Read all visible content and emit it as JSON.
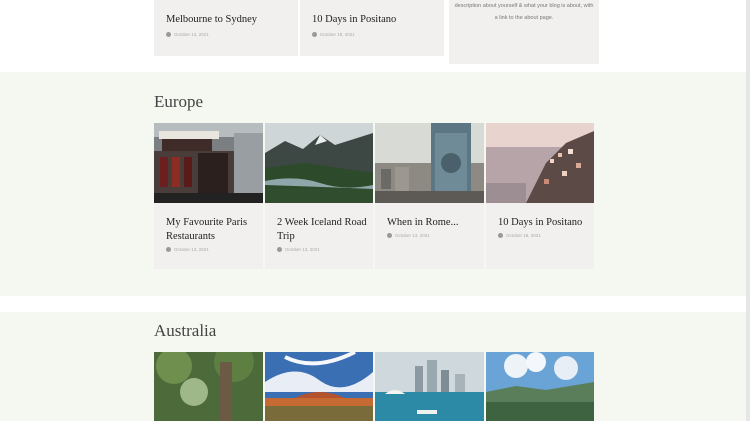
{
  "top_posts": [
    {
      "title": "Melbourne to Sydney",
      "date": "October 13, 2021"
    },
    {
      "title": "10 Days in Positano",
      "date": "October 18, 2021"
    }
  ],
  "about": {
    "text": "description about yourself & what your blog is about, with a link to the about page."
  },
  "sections": {
    "europe": {
      "title": "Europe",
      "posts": [
        {
          "title": "My Favourite Paris Restaurants",
          "date": "October 13, 2021",
          "image_icon": "paris-cafe-image"
        },
        {
          "title": "2 Week Iceland Road Trip",
          "date": "October 13, 2021",
          "image_icon": "iceland-fjord-image"
        },
        {
          "title": "When in Rome...",
          "date": "October 13, 2021",
          "image_icon": "rome-monument-image"
        },
        {
          "title": "10 Days in Positano",
          "date": "October 18, 2021",
          "image_icon": "positano-coast-image"
        }
      ]
    },
    "australia": {
      "title": "Australia",
      "posts": [
        {
          "image_icon": "rainforest-tree-image"
        },
        {
          "image_icon": "uluru-desert-image"
        },
        {
          "image_icon": "sydney-harbour-image"
        },
        {
          "image_icon": "blue-mountains-image"
        }
      ]
    }
  },
  "colors": {
    "background": "#f5f8f1",
    "card": "#f1f0ef",
    "heading": "#444444"
  }
}
